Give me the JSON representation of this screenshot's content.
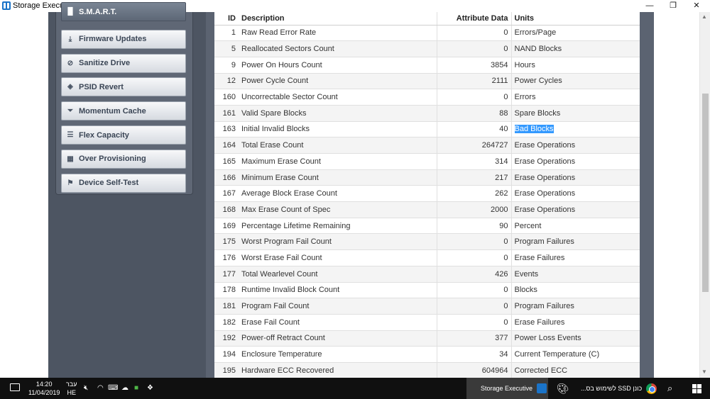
{
  "window": {
    "title": "Storage Executive",
    "minimize_glyph": "—",
    "maximize_glyph": "❐",
    "close_glyph": "✕"
  },
  "sidebar": {
    "items": [
      {
        "label": "S.M.A.R.T.",
        "icon": "chart-bars-icon",
        "glyph": "▐▌",
        "active": true
      },
      {
        "label": "Firmware Updates",
        "icon": "download-icon",
        "glyph": "⤓",
        "active": false
      },
      {
        "label": "Sanitize Drive",
        "icon": "prohibited-icon",
        "glyph": "⊘",
        "active": false
      },
      {
        "label": "PSID Revert",
        "icon": "tag-icon",
        "glyph": "◈",
        "active": false
      },
      {
        "label": "Momentum Cache",
        "icon": "funnel-icon",
        "glyph": "⏷",
        "active": false
      },
      {
        "label": "Flex Capacity",
        "icon": "list-icon",
        "glyph": "☰",
        "active": false
      },
      {
        "label": "Over Provisioning",
        "icon": "grid-icon",
        "glyph": "▦",
        "active": false
      },
      {
        "label": "Device Self-Test",
        "icon": "flag-icon",
        "glyph": "⚑",
        "active": false
      }
    ]
  },
  "table": {
    "columns": [
      "ID",
      "Description",
      "Attribute Data",
      "Units"
    ],
    "rows": [
      {
        "id": "1",
        "description": "Raw Read Error Rate",
        "data": "0",
        "units": "Errors/Page"
      },
      {
        "id": "5",
        "description": "Reallocated Sectors Count",
        "data": "0",
        "units": "NAND Blocks"
      },
      {
        "id": "9",
        "description": "Power On Hours Count",
        "data": "3854",
        "units": "Hours"
      },
      {
        "id": "12",
        "description": "Power Cycle Count",
        "data": "2111",
        "units": "Power Cycles"
      },
      {
        "id": "160",
        "description": "Uncorrectable Sector Count",
        "data": "0",
        "units": "Errors"
      },
      {
        "id": "161",
        "description": "Valid Spare Blocks",
        "data": "88",
        "units": "Spare Blocks"
      },
      {
        "id": "163",
        "description": "Initial Invalid Blocks",
        "data": "40",
        "units": "Bad Blocks",
        "selected": true
      },
      {
        "id": "164",
        "description": "Total Erase Count",
        "data": "264727",
        "units": "Erase Operations"
      },
      {
        "id": "165",
        "description": "Maximum Erase Count",
        "data": "314",
        "units": "Erase Operations"
      },
      {
        "id": "166",
        "description": "Minimum Erase Count",
        "data": "217",
        "units": "Erase Operations"
      },
      {
        "id": "167",
        "description": "Average Block Erase Count",
        "data": "262",
        "units": "Erase Operations"
      },
      {
        "id": "168",
        "description": "Max Erase Count of Spec",
        "data": "2000",
        "units": "Erase Operations"
      },
      {
        "id": "169",
        "description": "Percentage Lifetime Remaining",
        "data": "90",
        "units": "Percent"
      },
      {
        "id": "175",
        "description": "Worst Program Fail Count",
        "data": "0",
        "units": "Program Failures"
      },
      {
        "id": "176",
        "description": "Worst Erase Fail Count",
        "data": "0",
        "units": "Erase Failures"
      },
      {
        "id": "177",
        "description": "Total Wearlevel Count",
        "data": "426",
        "units": "Events"
      },
      {
        "id": "178",
        "description": "Runtime Invalid Block Count",
        "data": "0",
        "units": "Blocks"
      },
      {
        "id": "181",
        "description": "Program Fail Count",
        "data": "0",
        "units": "Program Failures"
      },
      {
        "id": "182",
        "description": "Erase Fail Count",
        "data": "0",
        "units": "Erase Failures"
      },
      {
        "id": "192",
        "description": "Power-off Retract Count",
        "data": "377",
        "units": "Power Loss Events"
      },
      {
        "id": "194",
        "description": "Enclosure Temperature",
        "data": "34",
        "units": "Current Temperature (C)"
      },
      {
        "id": "195",
        "description": "Hardware ECC Recovered",
        "data": "604964",
        "units": "Corrected ECC"
      }
    ]
  },
  "taskbar": {
    "time": "14:20",
    "date": "11/04/2019",
    "lang_top": "עבר",
    "lang_bottom": "HE",
    "tray_icons": [
      "volume-icon",
      "wifi-icon",
      "ime-icon",
      "cloud-icon",
      "app-tray-icon",
      "dropbox-icon"
    ],
    "tasks": [
      {
        "label": "Storage Executive",
        "icon": "storage-executive-icon",
        "active": true
      },
      {
        "label": "",
        "icon": "paint-icon",
        "active": false
      },
      {
        "label": "כונן SSD לשימוש בס...",
        "icon": "chrome-icon",
        "active": false
      }
    ]
  }
}
